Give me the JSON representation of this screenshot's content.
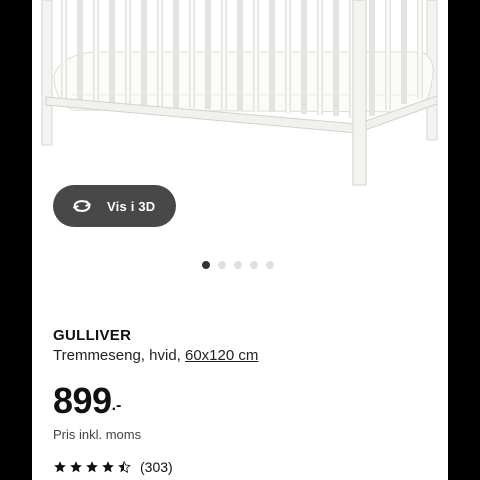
{
  "gallery": {
    "view_3d_label": "Vis i 3D",
    "image_count": 5,
    "active_index": 0
  },
  "product": {
    "name": "GULLIVER",
    "description": "Tremmeseng, hvid,",
    "size": "60x120 cm",
    "price_main": "899",
    "price_suffix": ".-",
    "vat_text": "Pris inkl. moms",
    "rating_value": 4.5,
    "rating_max": 5,
    "review_count": "(303)"
  },
  "colors": {
    "button_bg": "#484848",
    "dot_active": "#333333",
    "dot_inactive": "#dfdfdf"
  }
}
